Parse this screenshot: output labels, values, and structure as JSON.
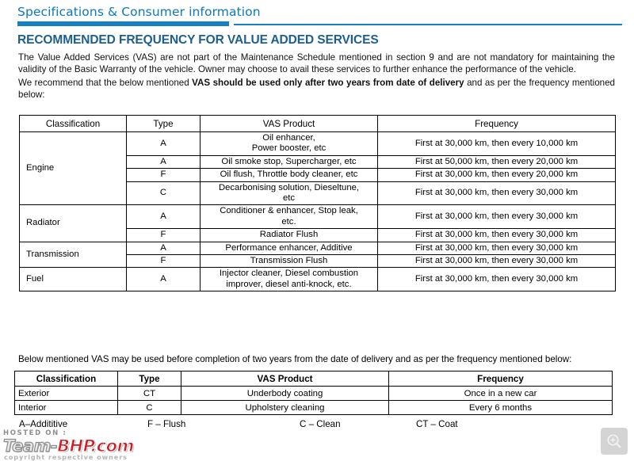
{
  "header": {
    "running_title": "Specifications & Consumer information"
  },
  "section": {
    "heading": "RECOMMENDED FREQUENCY FOR VALUE ADDED SERVICES",
    "para1": "The Value Added Services (VAS) are not part of the Maintenance Schedule mentioned in section 9 and are not mandatory for maintaining the validity of the Basic Warranty of the vehicle. Owner may choose to avail these services to further enhance the performance of the vehicle.",
    "para2_prefix": "We recommend that the below mentioned ",
    "para2_bold": "VAS should be used only after two years from date of delivery",
    "para2_suffix": " and as per the frequency mentioned below:"
  },
  "main_table": {
    "columns": [
      "Classification",
      "Type",
      "VAS Product",
      "Frequency"
    ],
    "groups": [
      {
        "classification": "Engine",
        "rows": [
          {
            "type": "A",
            "product": "Oil enhancer,\nPower booster, etc",
            "frequency": "First at 30,000 km, then every 10,000 km"
          },
          {
            "type": "A",
            "product": "Oil smoke stop, Supercharger, etc",
            "frequency": "First at 50,000 km, then every 20,000 km"
          },
          {
            "type": "F",
            "product": "Oil flush, Throttle body cleaner, etc",
            "frequency": "First at 30,000 km, then every 20,000 km"
          },
          {
            "type": "C",
            "product": "Decarbonising solution, Dieseltune,\netc",
            "frequency": "First at 30,000 km, then every 30,000 km"
          }
        ]
      },
      {
        "classification": "Radiator",
        "rows": [
          {
            "type": "A",
            "product": "Conditioner & enhancer, Stop leak,\netc.",
            "frequency": "First at 30,000 km, then every 30,000 km"
          },
          {
            "type": "F",
            "product": "Radiator Flush",
            "frequency": "First at 30,000 km, then every 30,000 km"
          }
        ]
      },
      {
        "classification": "Transmission",
        "rows": [
          {
            "type": "A",
            "product": "Performance enhancer, Additive",
            "frequency": "First at 30,000 km, then every 30,000 km"
          },
          {
            "type": "F",
            "product": "Transmission Flush",
            "frequency": "First at 30,000 km, then every 30,000 km"
          }
        ]
      },
      {
        "classification": "Fuel",
        "rows": [
          {
            "type": "A",
            "product": "Injector cleaner, Diesel combustion\nimprover, diesel anti-knock, etc.",
            "frequency": "First at 30,000 km, then every 30,000 km"
          }
        ]
      }
    ]
  },
  "mid_note": "Below mentioned VAS may be used before completion of two years from the date of delivery and as per the frequency mentioned below:",
  "small_table": {
    "columns": [
      "Classification",
      "Type",
      "VAS Product",
      "Frequency"
    ],
    "rows": [
      {
        "classification": "Exterior",
        "type": "CT",
        "product": "Underbody coating",
        "frequency": "Once in a new car"
      },
      {
        "classification": "Interior",
        "type": "C",
        "product": "Upholstery cleaning",
        "frequency": "Every 6 months"
      }
    ]
  },
  "legend": {
    "a": "A–Addititive",
    "f": "F – Flush",
    "c": "C – Clean",
    "ct": "CT – Coat"
  },
  "watermark": {
    "hosted_on": "HOSTED ON :",
    "brand_team": "Team-",
    "brand_bhp": "BHP.com",
    "copyright": "copyright respective owners"
  },
  "colors": {
    "accent_blue": "#1581c4",
    "header_blue": "#0b79bd",
    "heading_blue": "#1c5f8e",
    "brand_red": "#d01b22"
  }
}
